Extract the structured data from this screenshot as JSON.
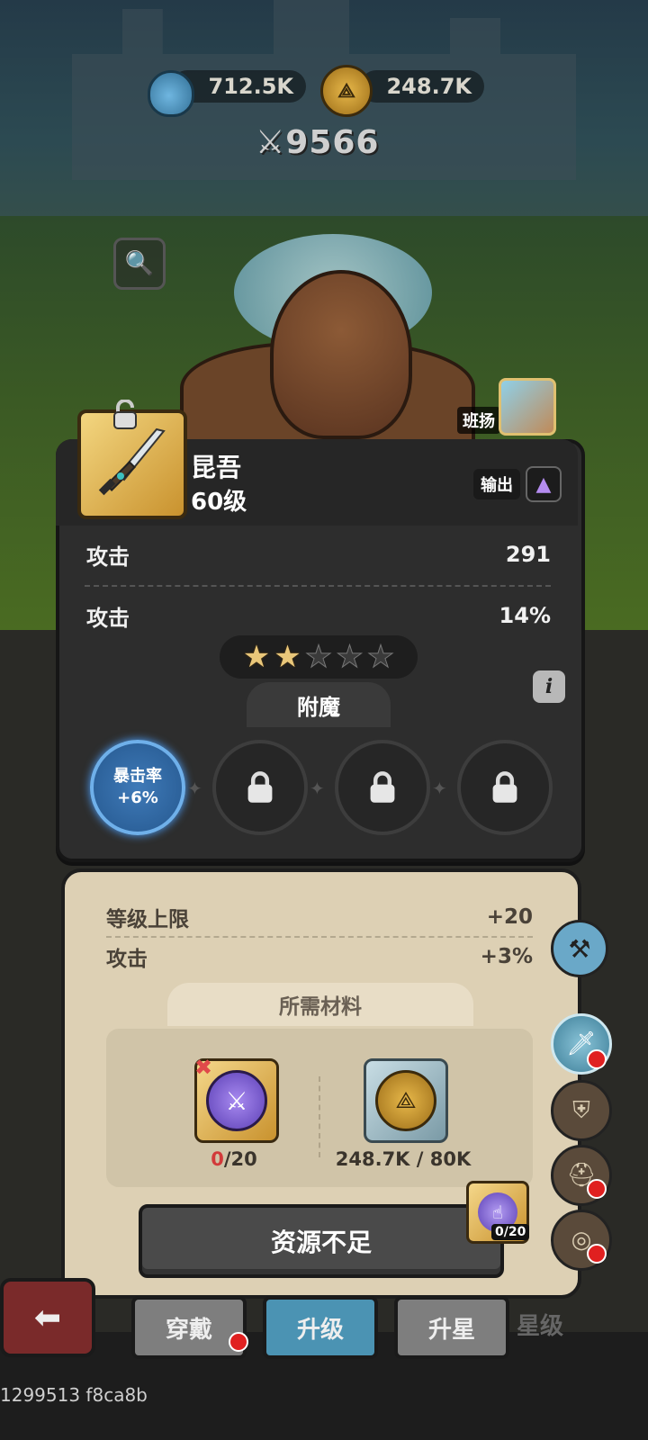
{
  "currency": {
    "potion_amount": "712.5K",
    "coin_amount": "248.7K",
    "power_value": "9566"
  },
  "hero": {
    "name_label": "班扬"
  },
  "weapon": {
    "name": "昆吾",
    "level": "60级",
    "role_label": "输出",
    "stars_filled": 2,
    "stars_total": 5,
    "stats": [
      {
        "label": "攻击",
        "value": "291"
      },
      {
        "label": "攻击",
        "value": "14%"
      }
    ]
  },
  "enchant": {
    "title": "附魔",
    "active_slot": {
      "line1": "暴击率",
      "line2": "+6%"
    }
  },
  "upgrade": {
    "bonuses": [
      {
        "label": "等级上限",
        "value": "+20"
      },
      {
        "label": "攻击",
        "value": "+3%"
      }
    ],
    "materials_title": "所需材料",
    "materials": [
      {
        "have": "0",
        "need": "/20"
      },
      {
        "text": "248.7K / 80K"
      }
    ],
    "action_button": "资源不足",
    "floating_count": "0/20"
  },
  "tabs": [
    {
      "label": "穿戴"
    },
    {
      "label": "升级"
    },
    {
      "label": "升星"
    },
    {
      "label": "星级"
    }
  ],
  "footer_text": "1299513 f8ca8b"
}
